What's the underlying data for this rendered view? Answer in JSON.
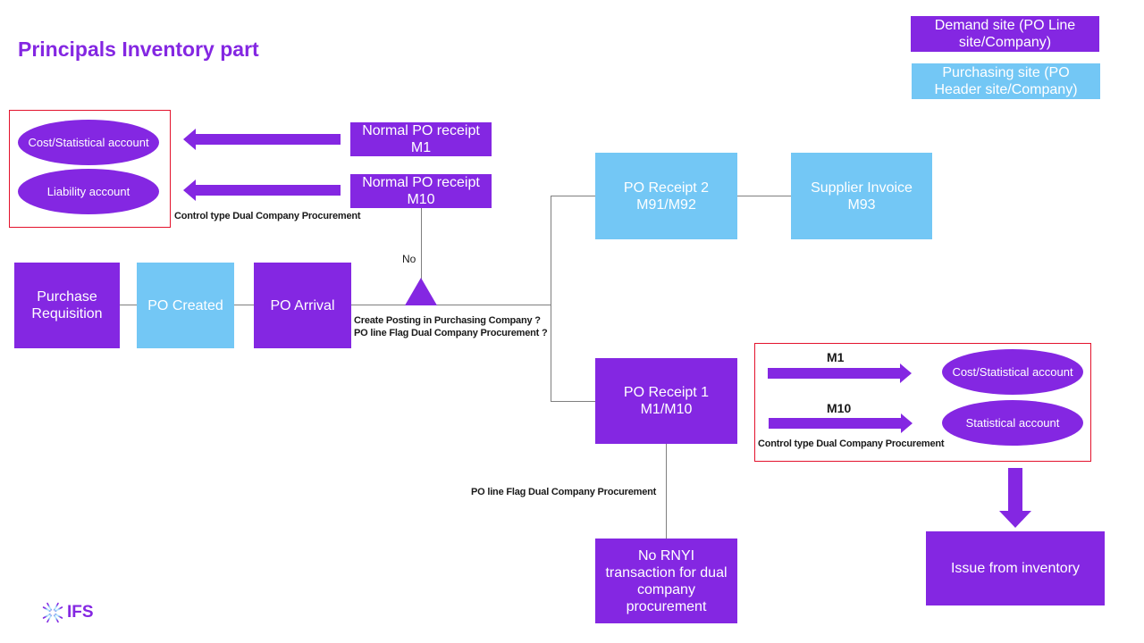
{
  "title": "Principals Inventory part",
  "legend": {
    "demand_site": "Demand site (PO Line site/Company)",
    "purchasing_site": "Purchasing site (PO Header site/Company)"
  },
  "colors": {
    "demand": "#8427e2",
    "purchasing": "#73c7f5",
    "highlight_frame": "#e3122c",
    "connector": "#7f7f7f"
  },
  "left_group": {
    "accounts": [
      "Cost/Statistical account",
      "Liability account"
    ],
    "receipts": [
      "Normal PO receipt M1",
      "Normal PO receipt M10"
    ],
    "control_note": "Control type Dual Company Procurement"
  },
  "main_flow": {
    "purchase_requisition": "Purchase Requisition",
    "po_created": "PO Created",
    "po_arrival": "PO Arrival"
  },
  "decision": {
    "no_label": "No",
    "question_line1": "Create Posting in Purchasing Company ?",
    "question_line2": "PO line Flag Dual Company Procurement ?"
  },
  "upper_branch": {
    "po_receipt_2": "PO Receipt 2 M91/M92",
    "supplier_invoice": "Supplier Invoice M93"
  },
  "lower_branch": {
    "po_receipt_1": "PO Receipt 1 M1/M10",
    "flag_note": "PO line Flag Dual Company Procurement",
    "no_rnyi": "No RNYI transaction for dual company procurement"
  },
  "right_group": {
    "arrows": [
      "M1",
      "M10"
    ],
    "accounts": [
      "Cost/Statistical account",
      "Statistical account"
    ],
    "control_note": "Control type Dual Company Procurement",
    "issue": "Issue from inventory"
  },
  "logo": {
    "text": "IFS",
    "icon": "ifs-starburst-icon"
  }
}
